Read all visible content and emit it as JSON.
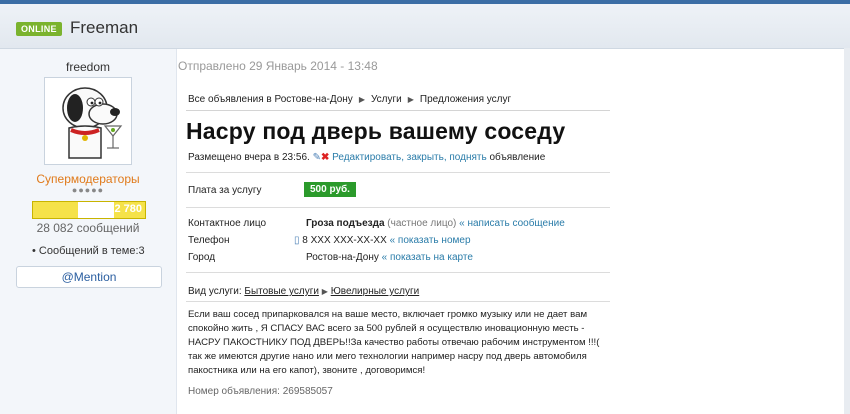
{
  "header": {
    "status_badge": "ONLINE",
    "username": "Freeman"
  },
  "sidebar": {
    "login": "freedom",
    "role": "Супермодераторы",
    "rank_dots": "●●●●●",
    "points": "2 780",
    "points_fill_fraction": 0.72,
    "messages": "28 082 сообщений",
    "in_thread": "Сообщений в теме:3",
    "mention_button": "@Mention"
  },
  "post": {
    "sent_label": "Отправлено 29 Январь 2014 - 13:48",
    "breadcrumb": [
      "Все объявления в Ростове-на-Дону",
      "Услуги",
      "Предложения услуг"
    ],
    "ad_title": "Насру под дверь вашему соседу",
    "posted_prefix": "Размещено вчера в 23:56.",
    "edit_link": "Редактировать, закрыть, поднять",
    "posted_suffix": "объявление",
    "price_label": "Плата за услугу",
    "price_value": "500 руб.",
    "contact_label": "Контактное лицо",
    "contact_name": "Гроза подъезда",
    "contact_type": "(частное лицо)",
    "write_message": "« написать сообщение",
    "phone_label": "Телефон",
    "phone_value": "8 XXX XXX-XX-XX",
    "show_number": "« показать номер",
    "city_label": "Город",
    "city_value": "Ростов-на-Дону",
    "show_map": "« показать на карте",
    "service_label": "Вид услуги:",
    "service_cat": "Бытовые услуги",
    "service_sub": "Ювелирные услуги",
    "description": "Если ваш сосед припарковался на ваше место, включает громко музыку или не дает вам спокойно жить , Я СПАСУ ВАС всего за 500 рублей я осуществлю иновационную месть - НАСРУ ПАКОСТНИКУ ПОД ДВЕРЬ!!За качество работы отвечаю рабочим инструментом !!!( так же имеются другие нано или мего технологии например насру под дверь автомобиля пакостника или на его капот), звоните , договоримся!",
    "ad_number": "Номер объявления: 269585057"
  }
}
